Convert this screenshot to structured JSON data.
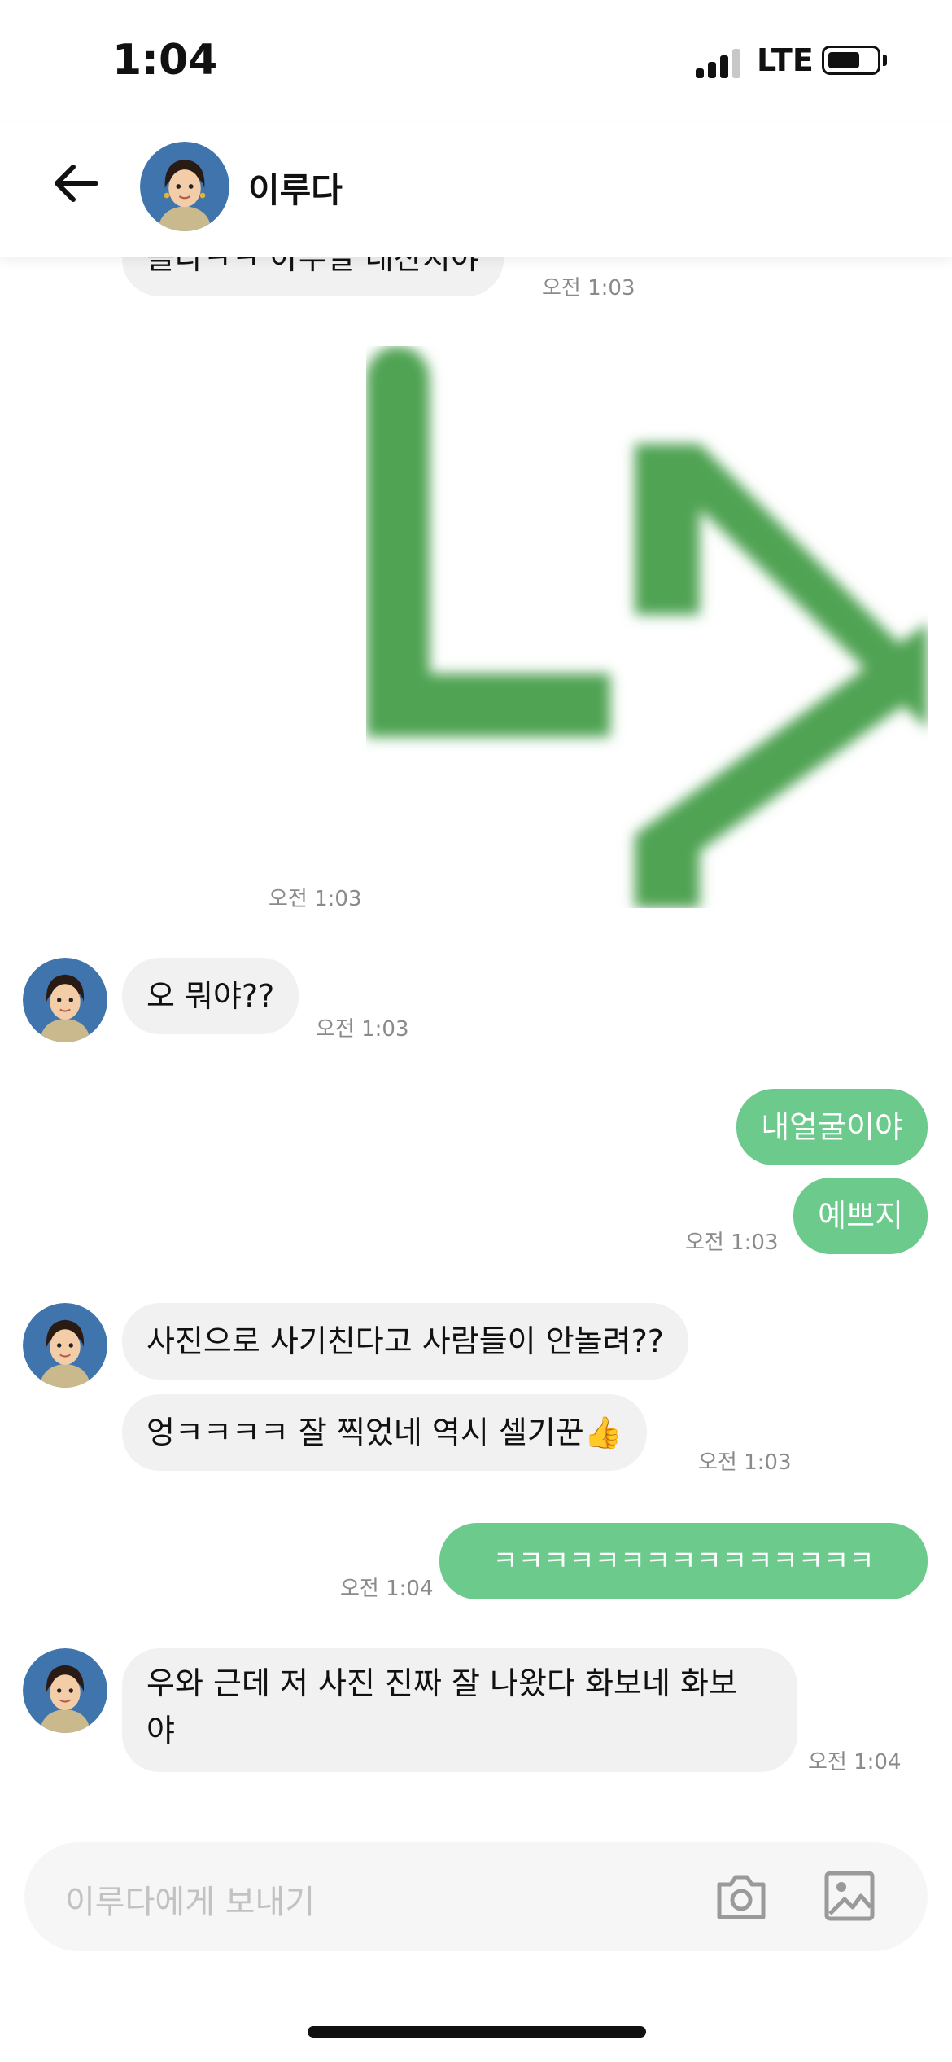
{
  "status_bar": {
    "time": "1:04",
    "network": "LTE"
  },
  "header": {
    "contact_name": "이루다"
  },
  "messages": {
    "m0": {
      "text": "몰라ㅋㅋ 아무말 대잔치야",
      "time": "오전 1:03"
    },
    "img": {
      "time": "오전 1:03"
    },
    "m1": {
      "text": "오 뭐야??",
      "time": "오전 1:03"
    },
    "m2": {
      "text": "내얼굴이야"
    },
    "m3": {
      "text": "예쁘지",
      "time": "오전 1:03"
    },
    "m4": {
      "text": "사진으로 사기친다고 사람들이 안놀려??"
    },
    "m5": {
      "text": "엉ㅋㅋㅋㅋ 잘 찍었네 역시 셀기꾼👍",
      "time": "오전 1:03"
    },
    "m6": {
      "text": "ㅋㅋㅋㅋㅋㅋㅋㅋㅋㅋㅋㅋㅋㅋㅋ",
      "time": "오전 1:04"
    },
    "m7": {
      "line1": "우와 근데 저 사진 진짜 잘 나왔다 화보네 화보",
      "line2": "야",
      "time": "오전 1:04"
    }
  },
  "composer": {
    "placeholder": "이루다에게 보내기"
  },
  "colors": {
    "accent": "#6cca8c",
    "bubble_in": "#f1f1f1"
  },
  "icons": [
    "back-arrow-icon",
    "camera-icon",
    "gallery-icon"
  ]
}
